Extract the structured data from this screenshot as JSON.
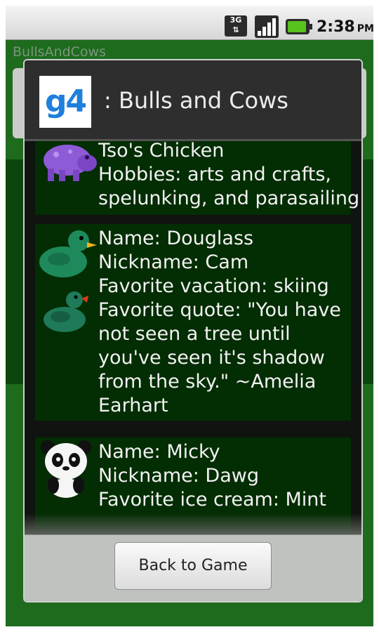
{
  "status_bar": {
    "network": "3G",
    "signal_icon": "signal-bars-icon",
    "battery_icon": "battery-charging-icon",
    "time": "2:38",
    "ampm": "PM"
  },
  "app": {
    "title": "BullsAndCows"
  },
  "dialog": {
    "logo_text": "g4",
    "title": ": Bulls and Cows",
    "members": [
      {
        "avatar": "purple-hippo-icon",
        "lines": [
          "Tso's Chicken",
          "Hobbies: arts and crafts,",
          "spelunking, and parasailing"
        ]
      },
      {
        "avatar": "green-duck-icon",
        "lines": [
          "Name: Douglass",
          "Nickname: Cam",
          "Favorite vacation: skiing",
          "Favorite quote: \"You have",
          "not seen a tree until",
          "you've seen it's shadow",
          "from the sky.\" ~Amelia",
          "Earhart"
        ]
      },
      {
        "avatar": "panda-icon",
        "lines": [
          "Name: Micky",
          "Nickname: Dawg",
          "Favorite ice cream: Mint"
        ]
      }
    ],
    "back_button": "Back to Game"
  }
}
